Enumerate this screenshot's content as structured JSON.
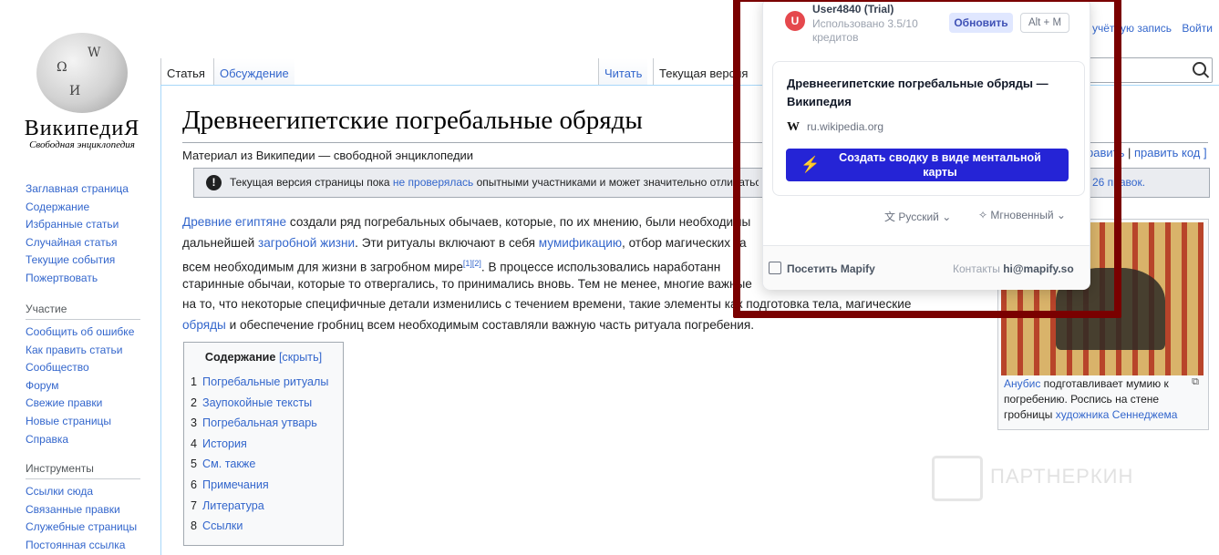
{
  "logo": {
    "word": "ВикипедиЯ",
    "tagline": "Свободная энциклопедия"
  },
  "nav_main": [
    "Заглавная страница",
    "Содержание",
    "Избранные статьи",
    "Случайная статья",
    "Текущие события",
    "Пожертвовать"
  ],
  "nav_participation": {
    "header": "Участие",
    "items": [
      "Сообщить об ошибке",
      "Как править статьи",
      "Сообщество",
      "Форум",
      "Свежие правки",
      "Новые страницы",
      "Справка"
    ]
  },
  "nav_tools": {
    "header": "Инструменты",
    "items": [
      "Ссылки сюда",
      "Связанные правки",
      "Служебные страницы",
      "Постоянная ссылка"
    ]
  },
  "tabs": {
    "article": "Статья",
    "discussion": "Обсуждение",
    "read": "Читать",
    "current": "Текущая версия"
  },
  "user_nav": {
    "account": "учётную запись",
    "login": "Войти"
  },
  "article": {
    "title": "Древнеегипетские погребальные обряды",
    "tagline": "Материал из Википедии — свободной энциклопедии",
    "edit_tail": "равить",
    "edit_sep": "|",
    "edit_code": "править код ]",
    "notice_pre": "Текущая версия страницы пока ",
    "notice_link": "не проверялась",
    "notice_post": " опытными участниками и может значительно отличаться от",
    "notice_revs": "26 правок.",
    "p1_a": "Древние египтяне",
    "p1_b": " создали ряд погребальных обычаев, которые, по их мнению, были необходимы",
    "p2_a": "дальнейшей ",
    "p2_link1": "загробной жизни",
    "p2_b": ". Эти ритуалы включают в себя ",
    "p2_link2": "мумификацию",
    "p2_c": ", отбор магических за",
    "p3_a": "всем необходимым для жизни в загробном мире",
    "p3_ref": "[1][2]",
    "p3_b": ". В процессе использовались наработанн",
    "p4": "старинные обычаи, которые то отвергались, то принимались вновь. Тем не менее, многие важные",
    "p5": "на то, что некоторые специфичные детали изменились с течением времени, такие элементы как подготовка тела, магические",
    "p6_link": "обряды",
    "p6_b": " и обеспечение гробниц всем необходимым составляли важную часть ритуала погребения."
  },
  "toc": {
    "title": "Содержание",
    "hide": "[скрыть]",
    "items": [
      {
        "n": "1",
        "t": "Погребальные ритуалы"
      },
      {
        "n": "2",
        "t": "Заупокойные тексты"
      },
      {
        "n": "3",
        "t": "Погребальная утварь"
      },
      {
        "n": "4",
        "t": "История"
      },
      {
        "n": "5",
        "t": "См. также"
      },
      {
        "n": "6",
        "t": "Примечания"
      },
      {
        "n": "7",
        "t": "Литература"
      },
      {
        "n": "8",
        "t": "Ссылки"
      }
    ]
  },
  "thumb": {
    "cap_link1": "Анубис",
    "cap_a": " подготавливает мумию к погребению. Роспись на стене гробницы ",
    "cap_link2": "художника Сеннеджема"
  },
  "watermark": "ПАРТНЕРКИН",
  "popup": {
    "avatar": "U",
    "user": "User4840 (Trial)",
    "usage": "Использовано 3.5/10 кредитов",
    "update": "Обновить",
    "shortcut": "Alt + M",
    "page_title": "Древнеегипетские погребальные обряды — Википедия",
    "source_icon": "W",
    "source": "ru.wikipedia.org",
    "cta": "Создать сводку в виде ментальной карты",
    "language": "Русский",
    "mode": "Мгновенный",
    "visit": "Посетить Mapify",
    "contacts_label": "Контакты",
    "contacts_email": "hi@mapify.so"
  },
  "colors": {
    "link": "#3366cc",
    "frame": "#7a0000",
    "cta": "#2524d6"
  }
}
